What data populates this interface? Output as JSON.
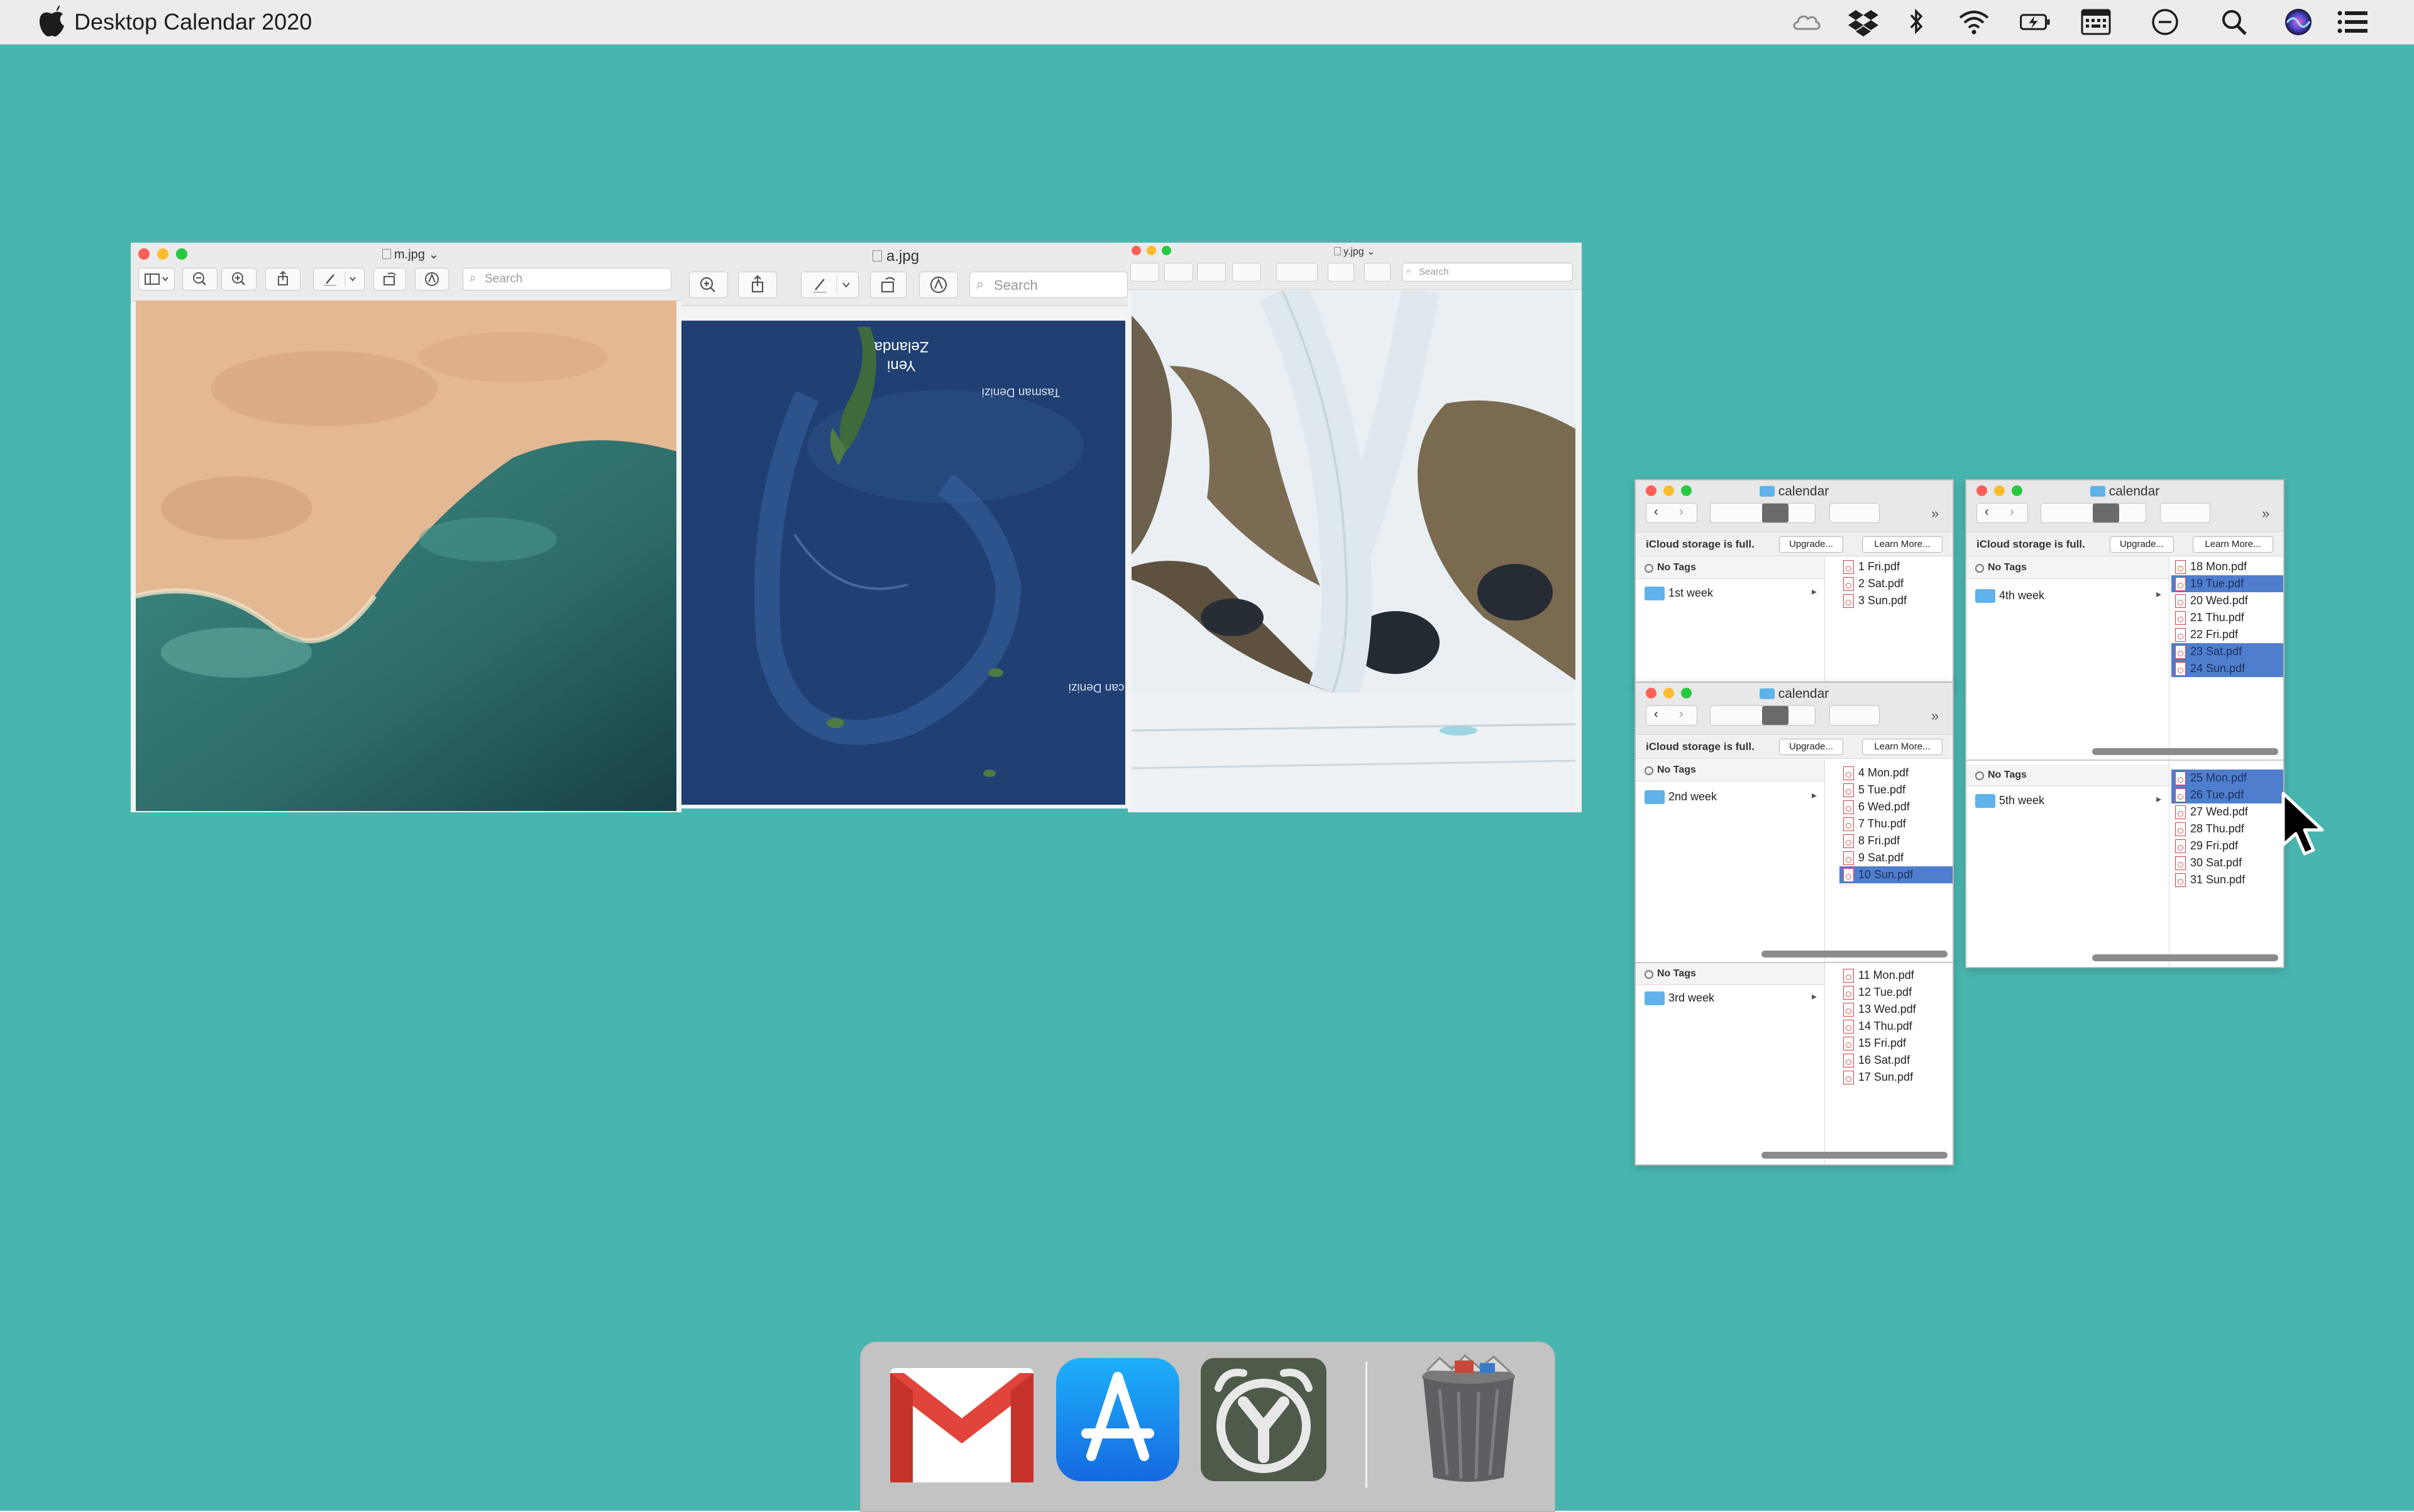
{
  "menubar": {
    "app_title": "Desktop Calendar 2020",
    "status_icons": [
      "icloud-icon",
      "dropbox-icon",
      "bluetooth-icon",
      "wifi-icon",
      "battery-icon",
      "keyboard-viewer-icon",
      "do-not-disturb-icon",
      "spotlight-icon",
      "siri-icon",
      "notification-center-icon"
    ]
  },
  "preview_windows": [
    {
      "title": "m.jpg",
      "search_placeholder": "Search"
    },
    {
      "title": "a.jpg",
      "search_placeholder": "Search",
      "map_labels": {
        "zealand": "Yeni\nZelanda",
        "tasman": "Tasman Denizi",
        "ocean": "can Denizi"
      }
    },
    {
      "title": "y.jpg",
      "search_placeholder": "Search"
    }
  ],
  "finder": {
    "title": "calendar",
    "icloud_message": "iCloud storage is full.",
    "upgrade_label": "Upgrade...",
    "learn_more_label": "Learn More...",
    "no_tags": "No Tags",
    "weeks": [
      {
        "folder": "1st week",
        "files": [
          {
            "name": "1 Fri.pdf",
            "selected": true
          },
          {
            "name": "2 Sat.pdf",
            "selected": false
          },
          {
            "name": "3 Sun.pdf",
            "selected": false
          }
        ]
      },
      {
        "folder": "2nd week",
        "files": [
          {
            "name": "4 Mon.pdf",
            "selected": false
          },
          {
            "name": "5 Tue.pdf",
            "selected": false
          },
          {
            "name": "6 Wed.pdf",
            "selected": false
          },
          {
            "name": "7 Thu.pdf",
            "selected": false
          },
          {
            "name": "8 Fri.pdf",
            "selected": false
          },
          {
            "name": "9 Sat.pdf",
            "selected": false
          },
          {
            "name": "10 Sun.pdf",
            "selected": true
          }
        ]
      },
      {
        "folder": "3rd week",
        "files": [
          {
            "name": "11 Mon.pdf",
            "selected": false
          },
          {
            "name": "12 Tue.pdf",
            "selected": false
          },
          {
            "name": "13 Wed.pdf",
            "selected": false
          },
          {
            "name": "14 Thu.pdf",
            "selected": false
          },
          {
            "name": "15 Fri.pdf",
            "selected": false
          },
          {
            "name": "16 Sat.pdf",
            "selected": false
          },
          {
            "name": "17 Sun.pdf",
            "selected": false
          }
        ]
      },
      {
        "folder": "4th week",
        "files": [
          {
            "name": "18 Mon.pdf",
            "selected": false
          },
          {
            "name": "19 Tue.pdf",
            "selected": true
          },
          {
            "name": "20 Wed.pdf",
            "selected": false
          },
          {
            "name": "21 Thu.pdf",
            "selected": false
          },
          {
            "name": "22 Fri.pdf",
            "selected": false
          },
          {
            "name": "23 Sat.pdf",
            "selected": true
          },
          {
            "name": "24 Sun.pdf",
            "selected": true
          }
        ]
      },
      {
        "folder": "5th week",
        "files": [
          {
            "name": "25 Mon.pdf",
            "selected": true
          },
          {
            "name": "26 Tue.pdf",
            "selected": true
          },
          {
            "name": "27 Wed.pdf",
            "selected": false
          },
          {
            "name": "28 Thu.pdf",
            "selected": false
          },
          {
            "name": "29 Fri.pdf",
            "selected": false
          },
          {
            "name": "30 Sat.pdf",
            "selected": false
          },
          {
            "name": "31 Sun.pdf",
            "selected": false
          }
        ]
      }
    ]
  },
  "dock": {
    "apps": [
      "gmail-app-icon",
      "app-store-app-icon",
      "alarm-clock-app-icon",
      "trash-icon"
    ]
  },
  "colors": {
    "desktop": "#48b6af",
    "selection": "#4f7ecf",
    "folder": "#5fb2ea"
  }
}
